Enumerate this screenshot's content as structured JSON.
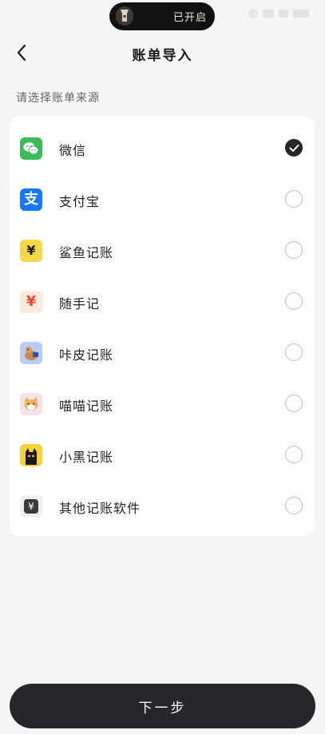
{
  "status_bar": {
    "torch_label": "已开启"
  },
  "header": {
    "title": "账单导入"
  },
  "section_label": "请选择账单来源",
  "sources": [
    {
      "name": "微信",
      "icon": "wechat-icon",
      "selected": true
    },
    {
      "name": "支付宝",
      "icon": "alipay-icon",
      "selected": false
    },
    {
      "name": "鲨鱼记账",
      "icon": "shark-ledger-icon",
      "selected": false
    },
    {
      "name": "随手记",
      "icon": "suishouji-icon",
      "selected": false
    },
    {
      "name": "咔皮记账",
      "icon": "kapi-ledger-icon",
      "selected": false
    },
    {
      "name": "喵喵记账",
      "icon": "cat-ledger-icon",
      "selected": false
    },
    {
      "name": "小黑记账",
      "icon": "black-cat-ledger-icon",
      "selected": false
    },
    {
      "name": "其他记账软件",
      "icon": "other-ledger-icon",
      "selected": false
    }
  ],
  "next_button_label": "下一步",
  "colors": {
    "background": "#f5f5f5",
    "card": "#ffffff",
    "primary_dark": "#26272b",
    "wechat_green": "#3dbb5c",
    "alipay_blue": "#1677ff",
    "shark_yellow": "#f7d84a",
    "suishouji_red": "#e84a3a"
  }
}
